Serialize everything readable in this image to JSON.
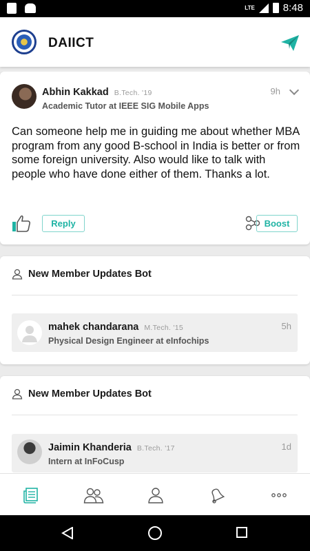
{
  "status_bar": {
    "time": "8:48",
    "network": "LTE"
  },
  "app_bar": {
    "title": "DAIICT"
  },
  "post": {
    "author_name": "Abhin Kakkad",
    "author_batch": "B.Tech. '19",
    "author_role": "Academic Tutor at IEEE SIG Mobile Apps",
    "time": "9h",
    "body": "Can someone help me in guiding me about whether MBA program from any good B-school in India is better or from some foreign university. Also would like to talk with people who have done either of them. Thanks a lot.",
    "reply_label": "Reply",
    "boost_label": "Boost"
  },
  "bot_cards": [
    {
      "title": "New Member Updates Bot",
      "member_name": "mahek chandarana",
      "member_batch": "M.Tech. '15",
      "member_role": "Physical Design Engineer at eInfochips",
      "time": "5h"
    },
    {
      "title": "New Member Updates Bot",
      "member_name": "Jaimin Khanderia",
      "member_batch": "B.Tech. '17",
      "member_role": "Intern at InFoCusp",
      "time": "1d"
    }
  ],
  "bottom_nav": {
    "items": [
      {
        "icon": "feed-icon",
        "active": true
      },
      {
        "icon": "people-icon",
        "active": false
      },
      {
        "icon": "profile-icon",
        "active": false
      },
      {
        "icon": "notifications-bell-icon",
        "active": false
      },
      {
        "icon": "more-icon",
        "active": false
      }
    ]
  },
  "colors": {
    "accent": "#1fb3a4",
    "brand": "#1d3f8f"
  }
}
